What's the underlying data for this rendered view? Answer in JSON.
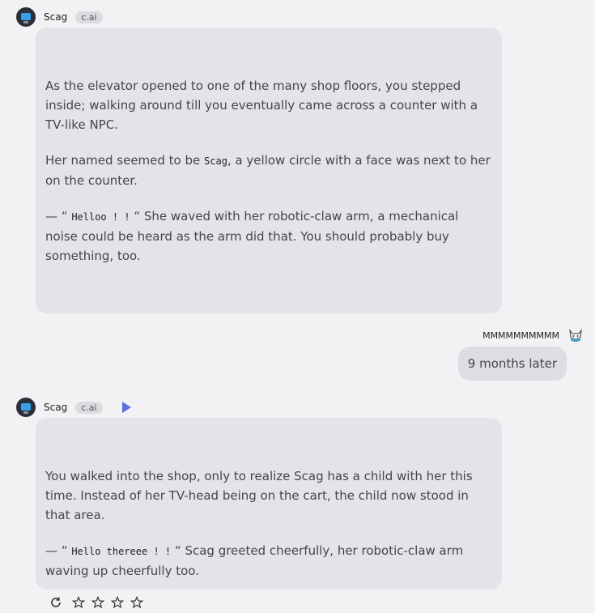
{
  "messages": [
    {
      "sender": "Scag",
      "badge": "c.ai",
      "paragraphs": [
        {
          "text": "As the elevator opened to one of the many shop floors, you stepped inside; walking around till you eventually came across a counter with a TV-like NPC."
        },
        {
          "before": "Her named seemed to be ",
          "code": "Scag",
          "after": ", a yellow circle with a face was next to her on the counter."
        },
        {
          "before": "— “ ",
          "code": "Helloo ! !",
          "after": " “ She waved with her robotic-claw arm, a mechanical noise could be heard as the arm did that. You should probably buy something, too."
        }
      ]
    },
    {
      "sender": "MMMMMMMMMM",
      "text": "9 months later"
    },
    {
      "sender": "Scag",
      "badge": "c.ai",
      "paragraphs": [
        {
          "text": "You walked into the shop, only to realize Scag has a child with her this time. Instead of her TV-head being on the cart, the child now stood in that area."
        },
        {
          "before": "— “ ",
          "code": "Hello thereee ! !",
          "after": " “ Scag greeted cheerfully, her robotic-claw arm waving up cheerfully too."
        }
      ]
    }
  ],
  "icons": {
    "play": "play-icon",
    "refresh": "refresh-icon",
    "star": "star-icon"
  },
  "rating": {
    "max": 5,
    "value": 0
  },
  "colors": {
    "accent": "#5a73e0",
    "bubble": "#e4e4e8",
    "background": "#f2f2f4"
  }
}
